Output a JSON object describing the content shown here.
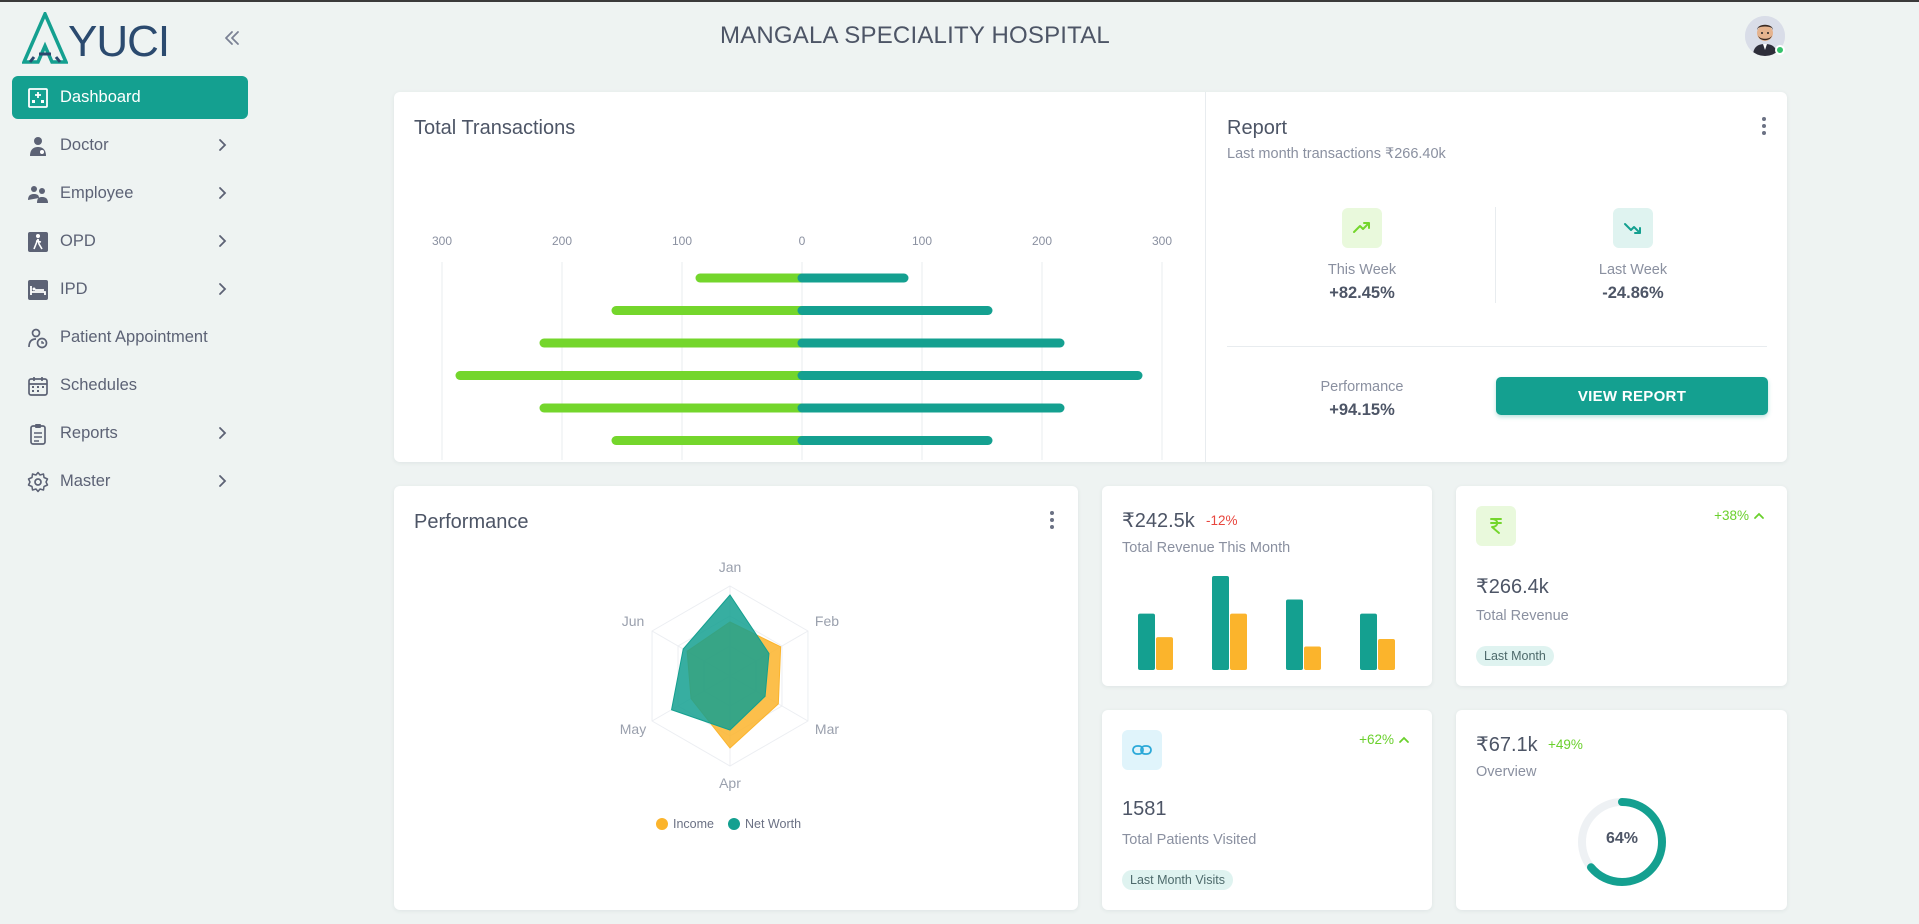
{
  "app": {
    "logo_text": "YUCI",
    "logo_letter": "A",
    "hospital_name": "MANGALA SPECIALITY HOSPITAL",
    "collapse_icon": "chevrons-left-icon"
  },
  "sidebar": {
    "items": [
      {
        "label": "Dashboard",
        "icon": "hospital-building-icon",
        "active": true,
        "has_children": false
      },
      {
        "label": "Doctor",
        "icon": "doctor-icon",
        "active": false,
        "has_children": true
      },
      {
        "label": "Employee",
        "icon": "group-icon",
        "active": false,
        "has_children": true
      },
      {
        "label": "OPD",
        "icon": "walking-person-icon",
        "active": false,
        "has_children": true
      },
      {
        "label": "IPD",
        "icon": "hospital-bed-icon",
        "active": false,
        "has_children": true
      },
      {
        "label": "Patient Appointment",
        "icon": "person-clock-icon",
        "active": false,
        "has_children": false
      },
      {
        "label": "Schedules",
        "icon": "calendar-icon",
        "active": false,
        "has_children": false
      },
      {
        "label": "Reports",
        "icon": "clipboard-icon",
        "active": false,
        "has_children": true
      },
      {
        "label": "Master",
        "icon": "gear-icon",
        "active": false,
        "has_children": true
      }
    ]
  },
  "transactions": {
    "title": "Total Transactions"
  },
  "report": {
    "title": "Report",
    "subtitle": "Last month transactions ₹266.40k",
    "this_week_label": "This Week",
    "this_week_value": "+82.45%",
    "last_week_label": "Last Week",
    "last_week_value": "-24.86%",
    "performance_label": "Performance",
    "performance_value": "+94.15%",
    "button_label": "VIEW REPORT"
  },
  "performance": {
    "title": "Performance"
  },
  "revenue_month": {
    "value": "₹242.5k",
    "change": "-12%",
    "label": "Total Revenue This Month"
  },
  "total_revenue": {
    "icon": "rupee-icon",
    "change": "+38%",
    "value": "₹266.4k",
    "label": "Total Revenue",
    "chip": "Last Month"
  },
  "patients": {
    "icon": "link-icon",
    "change": "+62%",
    "value": "1581",
    "label": "Total Patients Visited",
    "chip": "Last Month Visits"
  },
  "overview": {
    "value": "₹67.1k",
    "change": "+49%",
    "label": "Overview",
    "progress_label": "64%",
    "progress": 0.64
  },
  "colors": {
    "primary": "#14a090",
    "green": "#74d62c",
    "orange": "#fbb42c",
    "red": "#e8463e"
  },
  "chart_data": [
    {
      "type": "bar",
      "orientation": "horizontal-diverging",
      "title": "Total Transactions",
      "xticks": [
        "300",
        "200",
        "100",
        "0",
        "100",
        "200",
        "300"
      ],
      "xlim": [
        -300,
        300
      ],
      "series": [
        {
          "values": [
            -85,
            -155,
            -215,
            -285,
            -215,
            -155,
            -85
          ]
        },
        {
          "values": [
            85,
            155,
            215,
            280,
            215,
            155,
            85
          ]
        }
      ],
      "grid": true
    },
    {
      "type": "radar",
      "categories": [
        "Jan",
        "Feb",
        "Mar",
        "Apr",
        "May",
        "Jun"
      ],
      "max": 100,
      "series": [
        {
          "name": "Income",
          "values": [
            60,
            65,
            62,
            80,
            50,
            55
          ]
        },
        {
          "name": "Net Worth",
          "values": [
            90,
            50,
            45,
            60,
            75,
            60
          ]
        }
      ],
      "legend": "bottom"
    },
    {
      "type": "bar",
      "categories": [
        "1",
        "2",
        "3",
        "4"
      ],
      "series": [
        {
          "values": [
            60,
            100,
            75,
            60
          ]
        },
        {
          "values": [
            35,
            60,
            25,
            33
          ]
        }
      ],
      "ylim": [
        0,
        100
      ]
    }
  ]
}
